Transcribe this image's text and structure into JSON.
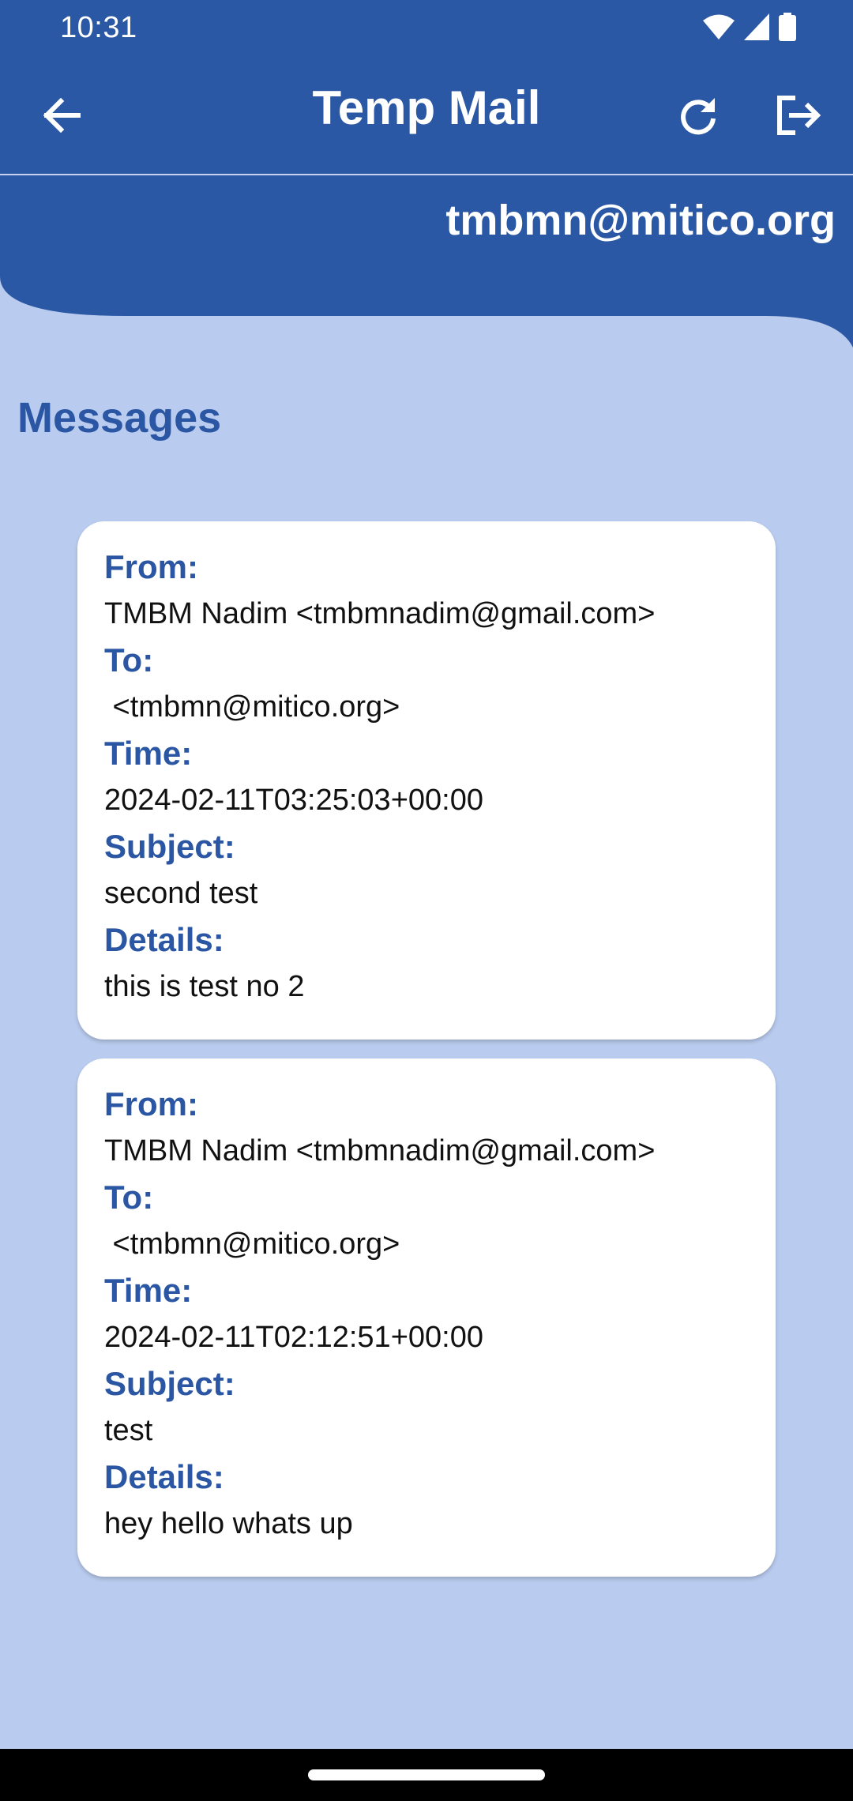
{
  "colors": {
    "primary": "#2b58a4",
    "background": "#b9cbee",
    "label": "#2a56a3",
    "card": "#ffffff"
  },
  "status_bar": {
    "time": "10:31",
    "icons": [
      "wifi-icon",
      "signal-icon",
      "battery-icon"
    ]
  },
  "app_bar": {
    "title": "Temp Mail",
    "icons": [
      "arrow-left-icon",
      "refresh-icon",
      "logout-icon"
    ]
  },
  "email_address": "tmbmn@mitico.org",
  "section_title": "Messages",
  "messages": [
    {
      "from_label": "From:",
      "from": "TMBM Nadim <tmbmnadim@gmail.com>",
      "to_label": "To:",
      "to": " <tmbmn@mitico.org>",
      "time_label": "Time:",
      "time": "2024-02-11T03:25:03+00:00",
      "subject_label": "Subject:",
      "subject": "second test",
      "details_label": "Details:",
      "details": "this is test no 2"
    },
    {
      "from_label": "From:",
      "from": "TMBM Nadim <tmbmnadim@gmail.com>",
      "to_label": "To:",
      "to": " <tmbmn@mitico.org>",
      "time_label": "Time:",
      "time": "2024-02-11T02:12:51+00:00",
      "subject_label": "Subject:",
      "subject": "test",
      "details_label": "Details:",
      "details": "hey hello whats up"
    }
  ]
}
